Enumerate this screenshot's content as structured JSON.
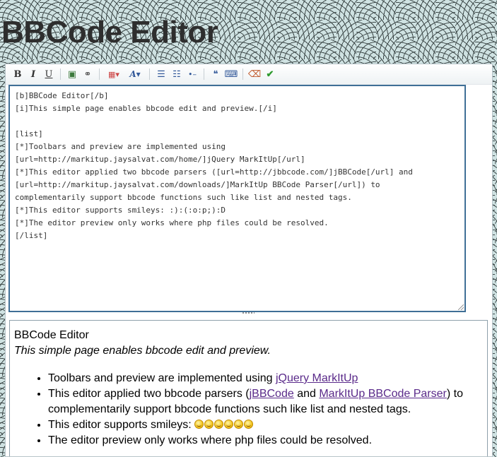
{
  "page": {
    "title": "BBCode Editor"
  },
  "toolbar": {
    "buttons": [
      {
        "name": "bold-button",
        "icon": "bold-icon",
        "glyph": "B"
      },
      {
        "name": "italic-button",
        "icon": "italic-icon",
        "glyph": "I"
      },
      {
        "name": "underline-button",
        "icon": "underline-icon",
        "glyph": "U"
      },
      {
        "name": "picture-button",
        "icon": "picture-icon",
        "glyph": "▣"
      },
      {
        "name": "link-button",
        "icon": "link-icon",
        "glyph": "⚭"
      },
      {
        "name": "colors-button",
        "icon": "color-grid-icon",
        "glyph": "▦▾"
      },
      {
        "name": "font-size-button",
        "icon": "font-size-icon",
        "glyph": "A▾"
      },
      {
        "name": "bulleted-list-button",
        "icon": "bulleted-list-icon",
        "glyph": "☰"
      },
      {
        "name": "numeric-list-button",
        "icon": "numeric-list-icon",
        "glyph": "☷"
      },
      {
        "name": "list-item-button",
        "icon": "list-item-icon",
        "glyph": "•–"
      },
      {
        "name": "quotes-button",
        "icon": "quotes-icon",
        "glyph": "❝"
      },
      {
        "name": "code-button",
        "icon": "code-icon",
        "glyph": "⌨"
      },
      {
        "name": "clean-button",
        "icon": "clean-icon",
        "glyph": "⌫"
      },
      {
        "name": "preview-button",
        "icon": "checkmark-icon",
        "glyph": "✔"
      }
    ]
  },
  "editor": {
    "content": "[b]BBCode Editor[/b]\n[i]This simple page enables bbcode edit and preview.[/i]\n\n[list]\n[*]Toolbars and preview are implemented using\n[url=http://markitup.jaysalvat.com/home/]jQuery MarkItUp[/url]\n[*]This editor applied two bbcode parsers ([url=http://jbbcode.com/]jBBCode[/url] and\n[url=http://markitup.jaysalvat.com/downloads/]MarkItUp BBCode Parser[/url]) to\ncomplementarily support bbcode functions such like list and nested tags.\n[*]This editor supports smileys: :):(:o:p;):D\n[*]The editor preview only works where php files could be resolved.\n[/list]"
  },
  "preview": {
    "heading": "BBCode Editor",
    "subtitle": "This simple page enables bbcode edit and preview.",
    "items": {
      "item1_text": "Toolbars and preview are implemented using ",
      "item1_link": "jQuery MarkItUp",
      "item2_text_a": "This editor applied two bbcode parsers (",
      "item2_link_a": "jBBCode",
      "item2_text_b": " and ",
      "item2_link_b": "MarkItUp BBCode Parser",
      "item2_text_c": ") to complementarily support bbcode functions such like list and nested tags.",
      "item3_text": "This editor supports smileys: ",
      "item4_text": "The editor preview only works where php files could be resolved."
    },
    "smileys": [
      "smile-icon",
      "sad-icon",
      "surprised-icon",
      "tongue-icon",
      "wink-icon",
      "grin-icon"
    ]
  },
  "colors": {
    "editor_border": "#3f6f96",
    "link": "#5a2a8a",
    "background": "#cfe2e2"
  }
}
